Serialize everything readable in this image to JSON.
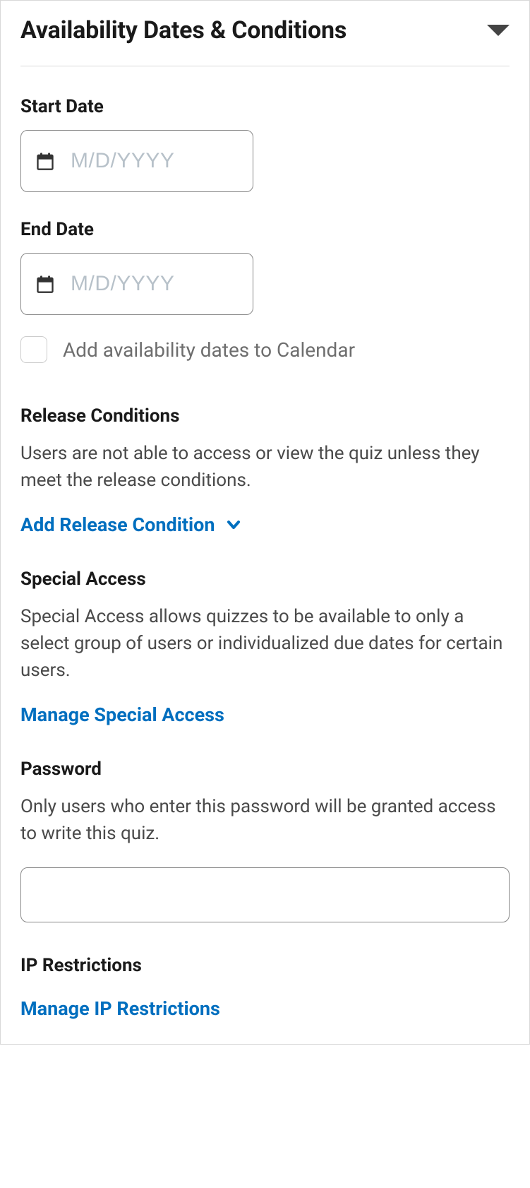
{
  "panel": {
    "title": "Availability Dates & Conditions"
  },
  "startDate": {
    "label": "Start Date",
    "placeholder": "M/D/YYYY",
    "value": ""
  },
  "endDate": {
    "label": "End Date",
    "placeholder": "M/D/YYYY",
    "value": ""
  },
  "calendarCheckbox": {
    "label": "Add availability dates to Calendar",
    "checked": false
  },
  "releaseConditions": {
    "title": "Release Conditions",
    "description": "Users are not able to access or view the quiz unless they meet the release conditions.",
    "action": "Add Release Condition"
  },
  "specialAccess": {
    "title": "Special Access",
    "description": "Special Access allows quizzes to be available to only a select group of users or individualized due dates for certain users.",
    "action": "Manage Special Access"
  },
  "password": {
    "title": "Password",
    "description": "Only users who enter this password will be granted access to write this quiz.",
    "value": ""
  },
  "ipRestrictions": {
    "title": "IP Restrictions",
    "action": "Manage IP Restrictions"
  }
}
